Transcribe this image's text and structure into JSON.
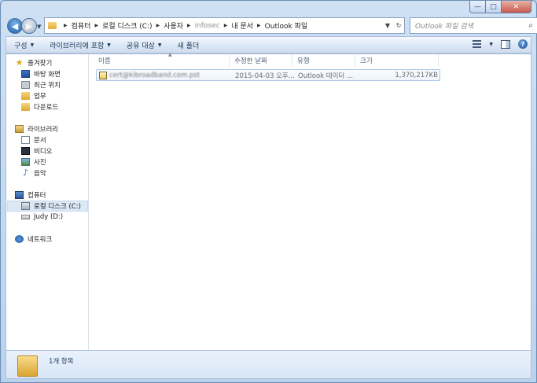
{
  "window": {
    "caption": {
      "minimize": "—",
      "maximize": "□",
      "close": "✕"
    }
  },
  "address": {
    "crumbs": [
      "컴퓨터",
      "로컬 디스크 (C:)",
      "사용자",
      "infosec",
      "내 문서",
      "Outlook 파일"
    ],
    "refresh": "↻"
  },
  "search": {
    "placeholder": "Outlook 파일 검색",
    "icon": "search-icon"
  },
  "toolbar": {
    "organize": "구성",
    "include_library": "라이브러리에 포함",
    "share": "공유 대상",
    "new_folder": "새 폴더"
  },
  "sidebar": {
    "favorites": {
      "title": "즐겨찾기",
      "items": [
        "바탕 화면",
        "최근 위치",
        "업무",
        "다운로드"
      ]
    },
    "libraries": {
      "title": "라이브러리",
      "items": [
        "문서",
        "비디오",
        "사진",
        "음악"
      ]
    },
    "computer": {
      "title": "컴퓨터",
      "items": [
        "로컬 디스크 (C:)",
        "Judy (D:)"
      ]
    },
    "network": {
      "title": "네트워크"
    }
  },
  "columns": [
    "이름",
    "수정한 날짜",
    "유형",
    "크기"
  ],
  "files": [
    {
      "name": "cert@kibroadband.com.pst",
      "modified": "2015-04-03 오후...",
      "type": "Outlook 데이터 ...",
      "size": "1,370,217KB"
    }
  ],
  "status": {
    "count": "1개 항목"
  }
}
